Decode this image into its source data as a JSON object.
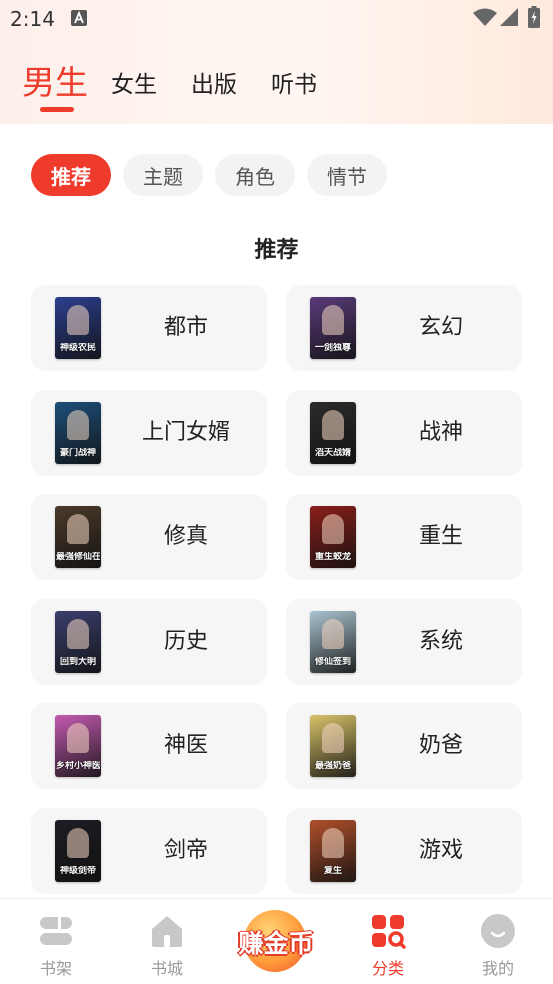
{
  "status_bar": {
    "time": "2:14"
  },
  "tabs": [
    {
      "label": "男生",
      "active": true
    },
    {
      "label": "女生",
      "active": false
    },
    {
      "label": "出版",
      "active": false
    },
    {
      "label": "听书",
      "active": false
    }
  ],
  "chips": [
    {
      "label": "推荐",
      "active": true
    },
    {
      "label": "主题",
      "active": false
    },
    {
      "label": "角色",
      "active": false
    },
    {
      "label": "情节",
      "active": false
    }
  ],
  "section_title": "推荐",
  "categories": [
    {
      "label": "都市",
      "cover_text": "神级农民",
      "cover_color": "#2c3f8f"
    },
    {
      "label": "玄幻",
      "cover_text": "一剑独尊",
      "cover_color": "#5a3b7a"
    },
    {
      "label": "上门女婿",
      "cover_text": "豪门战神",
      "cover_color": "#1d4f7a"
    },
    {
      "label": "战神",
      "cover_text": "滔天战婿",
      "cover_color": "#2b2b2b"
    },
    {
      "label": "修真",
      "cover_text": "最强修仙在都市",
      "cover_color": "#4b3a2a"
    },
    {
      "label": "重生",
      "cover_text": "重生蛟龙",
      "cover_color": "#8a1f1a"
    },
    {
      "label": "历史",
      "cover_text": "回到大明",
      "cover_color": "#3b3f6e"
    },
    {
      "label": "系统",
      "cover_text": "修仙签到",
      "cover_color": "#a9c3cf"
    },
    {
      "label": "神医",
      "cover_text": "乡村小神医",
      "cover_color": "#c45bb0"
    },
    {
      "label": "奶爸",
      "cover_text": "最强奶爸",
      "cover_color": "#d8c36a"
    },
    {
      "label": "剑帝",
      "cover_text": "神级剑帝",
      "cover_color": "#1d1d24"
    },
    {
      "label": "游戏",
      "cover_text": "复生",
      "cover_color": "#b0502a"
    }
  ],
  "coin_button": {
    "label": "赚金币"
  },
  "bottom_nav": [
    {
      "label": "书架",
      "icon": "bookshelf-icon",
      "active": false
    },
    {
      "label": "书城",
      "icon": "bookstore-icon",
      "active": false
    },
    {
      "label": "分类",
      "icon": "category-icon",
      "active": true
    },
    {
      "label": "我的",
      "icon": "profile-icon",
      "active": false
    }
  ],
  "colors": {
    "accent": "#ef3b2c",
    "chip_bg": "#f3f3f3",
    "card_bg": "#f6f6f6",
    "nav_inactive": "#999999"
  }
}
